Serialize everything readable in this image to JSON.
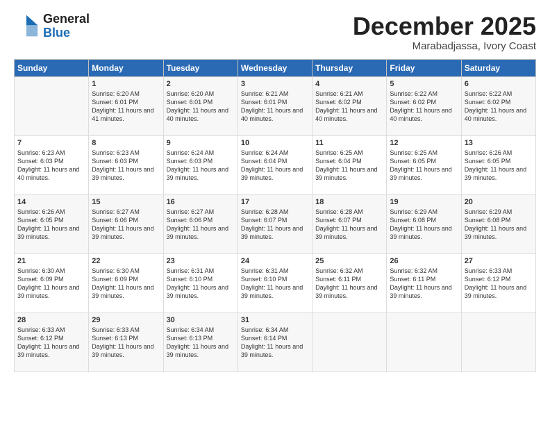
{
  "logo": {
    "general": "General",
    "blue": "Blue"
  },
  "title": "December 2025",
  "subtitle": "Marabadjassa, Ivory Coast",
  "days_of_week": [
    "Sunday",
    "Monday",
    "Tuesday",
    "Wednesday",
    "Thursday",
    "Friday",
    "Saturday"
  ],
  "weeks": [
    [
      {
        "day": "",
        "sunrise": "",
        "sunset": "",
        "daylight": ""
      },
      {
        "day": "1",
        "sunrise": "Sunrise: 6:20 AM",
        "sunset": "Sunset: 6:01 PM",
        "daylight": "Daylight: 11 hours and 41 minutes."
      },
      {
        "day": "2",
        "sunrise": "Sunrise: 6:20 AM",
        "sunset": "Sunset: 6:01 PM",
        "daylight": "Daylight: 11 hours and 40 minutes."
      },
      {
        "day": "3",
        "sunrise": "Sunrise: 6:21 AM",
        "sunset": "Sunset: 6:01 PM",
        "daylight": "Daylight: 11 hours and 40 minutes."
      },
      {
        "day": "4",
        "sunrise": "Sunrise: 6:21 AM",
        "sunset": "Sunset: 6:02 PM",
        "daylight": "Daylight: 11 hours and 40 minutes."
      },
      {
        "day": "5",
        "sunrise": "Sunrise: 6:22 AM",
        "sunset": "Sunset: 6:02 PM",
        "daylight": "Daylight: 11 hours and 40 minutes."
      },
      {
        "day": "6",
        "sunrise": "Sunrise: 6:22 AM",
        "sunset": "Sunset: 6:02 PM",
        "daylight": "Daylight: 11 hours and 40 minutes."
      }
    ],
    [
      {
        "day": "7",
        "sunrise": "Sunrise: 6:23 AM",
        "sunset": "Sunset: 6:03 PM",
        "daylight": "Daylight: 11 hours and 40 minutes."
      },
      {
        "day": "8",
        "sunrise": "Sunrise: 6:23 AM",
        "sunset": "Sunset: 6:03 PM",
        "daylight": "Daylight: 11 hours and 39 minutes."
      },
      {
        "day": "9",
        "sunrise": "Sunrise: 6:24 AM",
        "sunset": "Sunset: 6:03 PM",
        "daylight": "Daylight: 11 hours and 39 minutes."
      },
      {
        "day": "10",
        "sunrise": "Sunrise: 6:24 AM",
        "sunset": "Sunset: 6:04 PM",
        "daylight": "Daylight: 11 hours and 39 minutes."
      },
      {
        "day": "11",
        "sunrise": "Sunrise: 6:25 AM",
        "sunset": "Sunset: 6:04 PM",
        "daylight": "Daylight: 11 hours and 39 minutes."
      },
      {
        "day": "12",
        "sunrise": "Sunrise: 6:25 AM",
        "sunset": "Sunset: 6:05 PM",
        "daylight": "Daylight: 11 hours and 39 minutes."
      },
      {
        "day": "13",
        "sunrise": "Sunrise: 6:26 AM",
        "sunset": "Sunset: 6:05 PM",
        "daylight": "Daylight: 11 hours and 39 minutes."
      }
    ],
    [
      {
        "day": "14",
        "sunrise": "Sunrise: 6:26 AM",
        "sunset": "Sunset: 6:05 PM",
        "daylight": "Daylight: 11 hours and 39 minutes."
      },
      {
        "day": "15",
        "sunrise": "Sunrise: 6:27 AM",
        "sunset": "Sunset: 6:06 PM",
        "daylight": "Daylight: 11 hours and 39 minutes."
      },
      {
        "day": "16",
        "sunrise": "Sunrise: 6:27 AM",
        "sunset": "Sunset: 6:06 PM",
        "daylight": "Daylight: 11 hours and 39 minutes."
      },
      {
        "day": "17",
        "sunrise": "Sunrise: 6:28 AM",
        "sunset": "Sunset: 6:07 PM",
        "daylight": "Daylight: 11 hours and 39 minutes."
      },
      {
        "day": "18",
        "sunrise": "Sunrise: 6:28 AM",
        "sunset": "Sunset: 6:07 PM",
        "daylight": "Daylight: 11 hours and 39 minutes."
      },
      {
        "day": "19",
        "sunrise": "Sunrise: 6:29 AM",
        "sunset": "Sunset: 6:08 PM",
        "daylight": "Daylight: 11 hours and 39 minutes."
      },
      {
        "day": "20",
        "sunrise": "Sunrise: 6:29 AM",
        "sunset": "Sunset: 6:08 PM",
        "daylight": "Daylight: 11 hours and 39 minutes."
      }
    ],
    [
      {
        "day": "21",
        "sunrise": "Sunrise: 6:30 AM",
        "sunset": "Sunset: 6:09 PM",
        "daylight": "Daylight: 11 hours and 39 minutes."
      },
      {
        "day": "22",
        "sunrise": "Sunrise: 6:30 AM",
        "sunset": "Sunset: 6:09 PM",
        "daylight": "Daylight: 11 hours and 39 minutes."
      },
      {
        "day": "23",
        "sunrise": "Sunrise: 6:31 AM",
        "sunset": "Sunset: 6:10 PM",
        "daylight": "Daylight: 11 hours and 39 minutes."
      },
      {
        "day": "24",
        "sunrise": "Sunrise: 6:31 AM",
        "sunset": "Sunset: 6:10 PM",
        "daylight": "Daylight: 11 hours and 39 minutes."
      },
      {
        "day": "25",
        "sunrise": "Sunrise: 6:32 AM",
        "sunset": "Sunset: 6:11 PM",
        "daylight": "Daylight: 11 hours and 39 minutes."
      },
      {
        "day": "26",
        "sunrise": "Sunrise: 6:32 AM",
        "sunset": "Sunset: 6:11 PM",
        "daylight": "Daylight: 11 hours and 39 minutes."
      },
      {
        "day": "27",
        "sunrise": "Sunrise: 6:33 AM",
        "sunset": "Sunset: 6:12 PM",
        "daylight": "Daylight: 11 hours and 39 minutes."
      }
    ],
    [
      {
        "day": "28",
        "sunrise": "Sunrise: 6:33 AM",
        "sunset": "Sunset: 6:12 PM",
        "daylight": "Daylight: 11 hours and 39 minutes."
      },
      {
        "day": "29",
        "sunrise": "Sunrise: 6:33 AM",
        "sunset": "Sunset: 6:13 PM",
        "daylight": "Daylight: 11 hours and 39 minutes."
      },
      {
        "day": "30",
        "sunrise": "Sunrise: 6:34 AM",
        "sunset": "Sunset: 6:13 PM",
        "daylight": "Daylight: 11 hours and 39 minutes."
      },
      {
        "day": "31",
        "sunrise": "Sunrise: 6:34 AM",
        "sunset": "Sunset: 6:14 PM",
        "daylight": "Daylight: 11 hours and 39 minutes."
      },
      {
        "day": "",
        "sunrise": "",
        "sunset": "",
        "daylight": ""
      },
      {
        "day": "",
        "sunrise": "",
        "sunset": "",
        "daylight": ""
      },
      {
        "day": "",
        "sunrise": "",
        "sunset": "",
        "daylight": ""
      }
    ]
  ]
}
